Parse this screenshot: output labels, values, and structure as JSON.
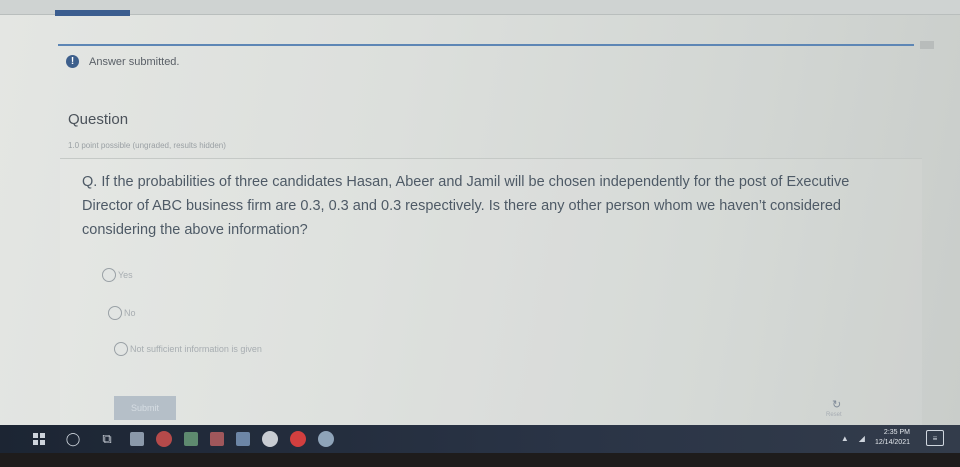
{
  "notice": {
    "text": "Answer submitted."
  },
  "question": {
    "heading": "Question",
    "meta": "1.0 point possible (ungraded, results hidden)",
    "text": "Q. If the probabilities of three candidates Hasan, Abeer and Jamil will be chosen independently for the post of Executive Director of ABC business firm are 0.3, 0.3 and 0.3 respectively. Is there any other person whom we haven’t considered considering the above information?",
    "options": [
      "Yes",
      "No",
      "Not sufficient information is given"
    ]
  },
  "submit": {
    "label": "Submit"
  },
  "reset": {
    "label": "Reset"
  },
  "icons": {
    "notice": "info-icon",
    "reset": "refresh-icon"
  },
  "taskbar": {
    "icons": [
      "windows-start-icon",
      "cortana-icon",
      "task-view-icon",
      "file-explorer-icon",
      "edge-icon",
      "store-icon",
      "photos-icon",
      "media-icon",
      "chrome-icon",
      "opera-icon",
      "teams-icon"
    ],
    "time": "2:35 PM",
    "date": "12/14/2021"
  },
  "colors": {
    "accent": "#3d5f8c",
    "progress": "#5d86b5",
    "text": "#4e5a66",
    "taskbar": "#1c2533"
  }
}
